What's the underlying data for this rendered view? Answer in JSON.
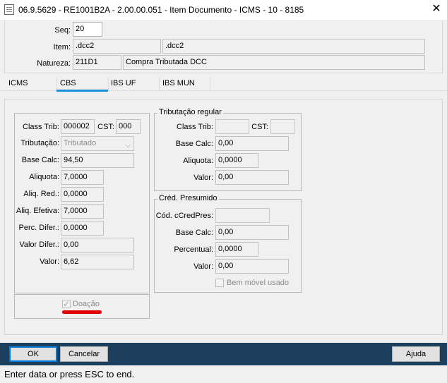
{
  "window": {
    "title": "06.9.5629 - RE1001B2A - 2.00.00.051 - Item Documento - ICMS - 10 - 8185",
    "close_glyph": "✕"
  },
  "header": {
    "seq_label": "Seq:",
    "seq_value": "20",
    "item_label": "Item:",
    "item_code": ".dcc2",
    "item_desc": ".dcc2",
    "natureza_label": "Natureza:",
    "natureza_code": "211D1",
    "natureza_desc": "Compra Tributada DCC"
  },
  "tabs": [
    {
      "label": "ICMS",
      "active": false
    },
    {
      "label": "CBS",
      "active": true
    },
    {
      "label": "IBS UF",
      "active": false
    },
    {
      "label": "IBS MUN",
      "active": false
    }
  ],
  "left_panel": {
    "class_trib_label": "Class Trib:",
    "class_trib_value": "000002",
    "cst_label": "CST:",
    "cst_value": "000",
    "tributacao_label": "Tributação:",
    "tributacao_value": "Tributado",
    "base_calc_label": "Base Calc:",
    "base_calc_value": "94,50",
    "aliquota_label": "Aliquota:",
    "aliquota_value": "7,0000",
    "aliq_red_label": "Aliq. Red.:",
    "aliq_red_value": "0,0000",
    "aliq_efetiva_label": "Aliq. Efetiva:",
    "aliq_efetiva_value": "7,0000",
    "perc_difer_label": "Perc. Difer.:",
    "perc_difer_value": "0,0000",
    "valor_difer_label": "Valor Difer.:",
    "valor_difer_value": "0,00",
    "valor_label": "Valor:",
    "valor_value": "6,62",
    "doacao_label": "Doação",
    "doacao_checked": true
  },
  "tributacao_regular": {
    "legend": "Tributação regular",
    "class_trib_label": "Class Trib:",
    "class_trib_value": "",
    "cst_label": "CST:",
    "cst_value": "",
    "base_calc_label": "Base Calc:",
    "base_calc_value": "0,00",
    "aliquota_label": "Aliquota:",
    "aliquota_value": "0,0000",
    "valor_label": "Valor:",
    "valor_value": "0,00"
  },
  "cred_presumido": {
    "legend": "Créd. Presumido",
    "cod_label": "Cód. cCredPres:",
    "cod_value": "",
    "base_calc_label": "Base Calc:",
    "base_calc_value": "0,00",
    "percentual_label": "Percentual:",
    "percentual_value": "0,0000",
    "valor_label": "Valor:",
    "valor_value": "0,00",
    "bem_movel_label": "Bem móvel usado",
    "bem_movel_checked": false
  },
  "buttons": {
    "ok": "OK",
    "cancelar": "Cancelar",
    "ajuda": "Ajuda"
  },
  "status_bar": {
    "text": "Enter data or press ESC to end."
  },
  "colors": {
    "tab_accent": "#1a8fd8",
    "bottom_bar": "#1c3f5e",
    "highlight_mark": "#e00000"
  }
}
